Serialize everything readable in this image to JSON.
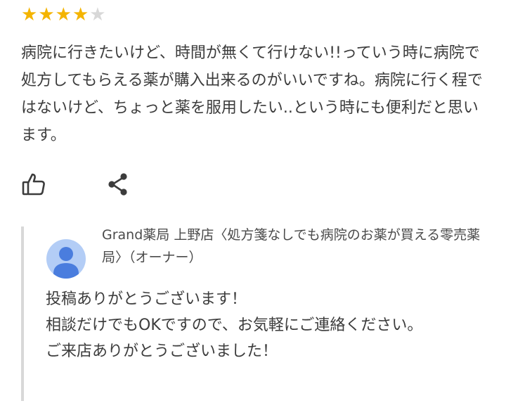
{
  "review": {
    "rating": 4,
    "rating_max": 5,
    "star_color": "#f4b400",
    "star_empty_color": "#d8d8d8",
    "text": "病院に行きたいけど、時間が無くて行けない!!っていう時に病院で処方してもらえる薬が購入出来るのがいいですね。病院に行く程ではないけど、ちょっと薬を服用したい..という時にも便利だと思います。"
  },
  "actions": {
    "like_icon": "thumbs-up-icon",
    "share_icon": "share-icon"
  },
  "owner_reply": {
    "avatar_icon": "person-avatar-icon",
    "avatar_color": "#b3cdf6",
    "owner_name": "Grand薬局 上野店〈処方箋なしでも病院のお薬が買える零売薬局〉（オーナー）",
    "text": "投稿ありがとうございます！\n相談だけでもOKですので、お気軽にご連絡ください。\nご来店ありがとうございました！"
  }
}
